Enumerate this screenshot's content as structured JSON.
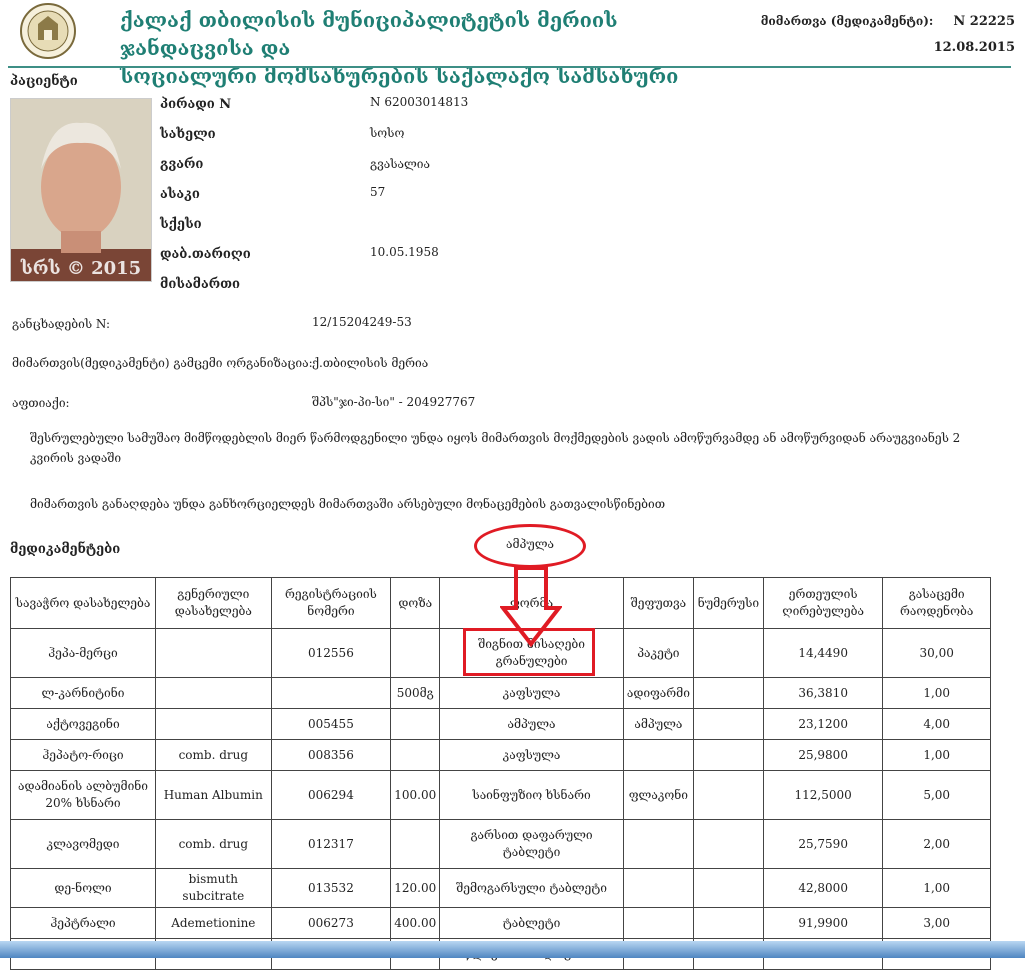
{
  "header": {
    "org_line1": "ქალაქ თბილისის მუნიციპალიტეტის მერიის ჯანდაცვისა და",
    "org_line2": "სოციალური მომსახურების საქალაქო სამსახური",
    "referral_label": "მიმართვა (მედიკამენტი):",
    "referral_number": "N 22225",
    "date": "12.08.2015"
  },
  "patient": {
    "section_label": "პაციენტი",
    "photo_watermark": "სრს © 2015",
    "fields": [
      {
        "label": "პირადი N",
        "value": "N 62003014813"
      },
      {
        "label": "სახელი",
        "value": "სოსო"
      },
      {
        "label": "გვარი",
        "value": "გვასალია"
      },
      {
        "label": "ასაკი",
        "value": "57"
      },
      {
        "label": "სქესი",
        "value": ""
      },
      {
        "label": "დაბ.თარიღი",
        "value": "10.05.1958"
      },
      {
        "label": "მისამართი",
        "value": ""
      }
    ]
  },
  "info": [
    {
      "label": "განცხადების N:",
      "value": "12/15204249-53"
    },
    {
      "label": "მიმართვის(მედიკამენტი) გამცემი ორგანიზაცია:",
      "value": "ქ.თბილისის მერია"
    },
    {
      "label": "აფთიაქი:",
      "value": "შპს\"ჯი-პი-სი\" - 204927767"
    }
  ],
  "notes": [
    "შესრულებული სამუშაო მიმწოდებლის მიერ წარმოდგენილი უნდა იყოს მიმართვის მოქმედების ვადის ამოწურვამდე ან ამოწურვიდან არაუგვიანეს 2 კვირის ვადაში",
    "მიმართვის განაღდება უნდა განხორციელდეს მიმართვაში არსებული მონაცემების გათვალისწინებით"
  ],
  "meds": {
    "section_label": "მედიკამენტები",
    "annotation_text": "ამპულა",
    "columns": [
      "სავაჭრო დასახელება",
      "გენერიული დასახელება",
      "რეგისტრაციის ნომერი",
      "დოზა",
      "ფორმა",
      "შეფუთვა",
      "ნუმერუსი",
      "ერთეულის ღირებულება",
      "გასაცემი რაოდენობა"
    ],
    "rows": [
      [
        "ჰეპა-მერცი",
        "",
        "012556",
        "",
        "შიგნით მისაღები გრანულები",
        "პაკეტი",
        "",
        "14,4490",
        "30,00"
      ],
      [
        "ლ-კარნიტინი",
        "",
        "",
        "500მგ",
        "კაფსულა",
        "ადიფარმი",
        "",
        "36,3810",
        "1,00"
      ],
      [
        "აქტოვეგინი",
        "",
        "005455",
        "",
        "ამპულა",
        "ამპულა",
        "",
        "23,1200",
        "4,00"
      ],
      [
        "ჰეპატო-რიცი",
        "comb. drug",
        "008356",
        "",
        "კაფსულა",
        "",
        "",
        "25,9800",
        "1,00"
      ],
      [
        "ადამიანის ალბუმინი 20% ხსნარი",
        "Human Albumin",
        "006294",
        "100.00",
        "საინფუზიო ხსნარი",
        "ფლაკონი",
        "",
        "112,5000",
        "5,00"
      ],
      [
        "კლავომედი",
        "comb. drug",
        "012317",
        "",
        "გარსით დაფარული ტაბლეტი",
        "",
        "",
        "25,7590",
        "2,00"
      ],
      [
        "დე-ნოლი",
        "bismuth subcitrate",
        "013532",
        "120.00",
        "შემოგარსული ტაბლეტი",
        "",
        "",
        "42,8000",
        "1,00"
      ],
      [
        "ჰეპტრალი",
        "Ademetionine",
        "006273",
        "400.00",
        "ტაბლეტი",
        "",
        "",
        "91,9900",
        "3,00"
      ],
      [
        "",
        "",
        "",
        "",
        "ნაწლავში ხსნადი გარსით",
        "",
        "",
        "",
        ""
      ]
    ]
  }
}
